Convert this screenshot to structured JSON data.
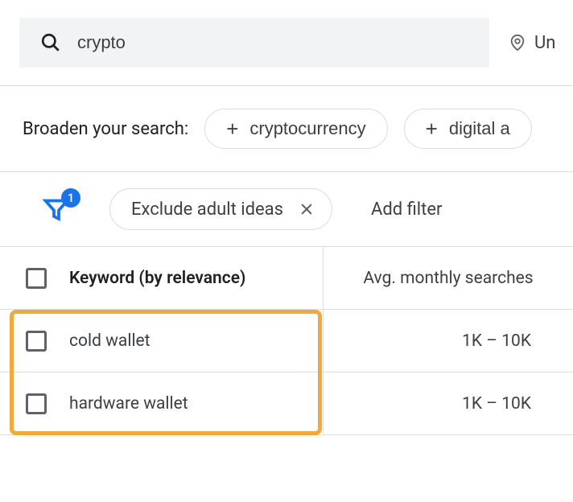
{
  "search": {
    "query": "crypto",
    "location_label": "Un"
  },
  "broaden": {
    "label": "Broaden your search:",
    "chips": [
      "cryptocurrency",
      "digital a"
    ]
  },
  "filter": {
    "count": "1",
    "active_filter": "Exclude adult ideas",
    "add_filter_label": "Add filter"
  },
  "table": {
    "header_keyword": "Keyword (by relevance)",
    "header_searches": "Avg. monthly searches",
    "rows": [
      {
        "keyword": "cold wallet",
        "searches": "1K – 10K"
      },
      {
        "keyword": "hardware wallet",
        "searches": "1K – 10K"
      }
    ]
  }
}
